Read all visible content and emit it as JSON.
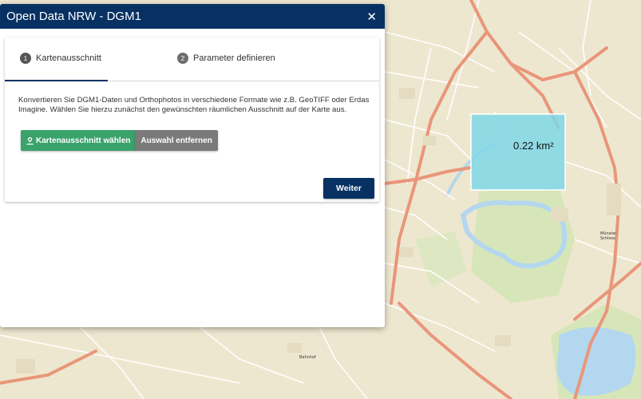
{
  "dialog": {
    "title": "Open Data NRW - DGM1",
    "close_icon": "close-icon",
    "steps": [
      {
        "number": "1",
        "label": "Kartenausschnitt"
      },
      {
        "number": "2",
        "label": "Parameter definieren"
      }
    ],
    "description": "Konvertieren Sie DGM1-Daten und Orthophotos in verschiedene Formate wie z.B. GeoTIFF oder Erdas Imagine. Wählen Sie hierzu zunächst den gewünschten räumlichen Ausschnitt auf der Karte aus.",
    "select_button": "Kartenausschnitt wählen",
    "select_button_icon": "map-marker-user-icon",
    "remove_button": "Auswahl entfernen",
    "next_button": "Weiter"
  },
  "map": {
    "selection_area": "0.22 km²",
    "labels": [
      "Bahnhof",
      "Münster Schloss"
    ]
  },
  "colors": {
    "titlebar": "#073163",
    "green_button": "#3aa26b",
    "grey_button": "#7a7a7a",
    "selection_fill": "#7fd7e6",
    "water": "#b3d7ee",
    "map_base": "#eee7cf",
    "road_major": "#e9967a",
    "park": "#d7e6b9"
  }
}
